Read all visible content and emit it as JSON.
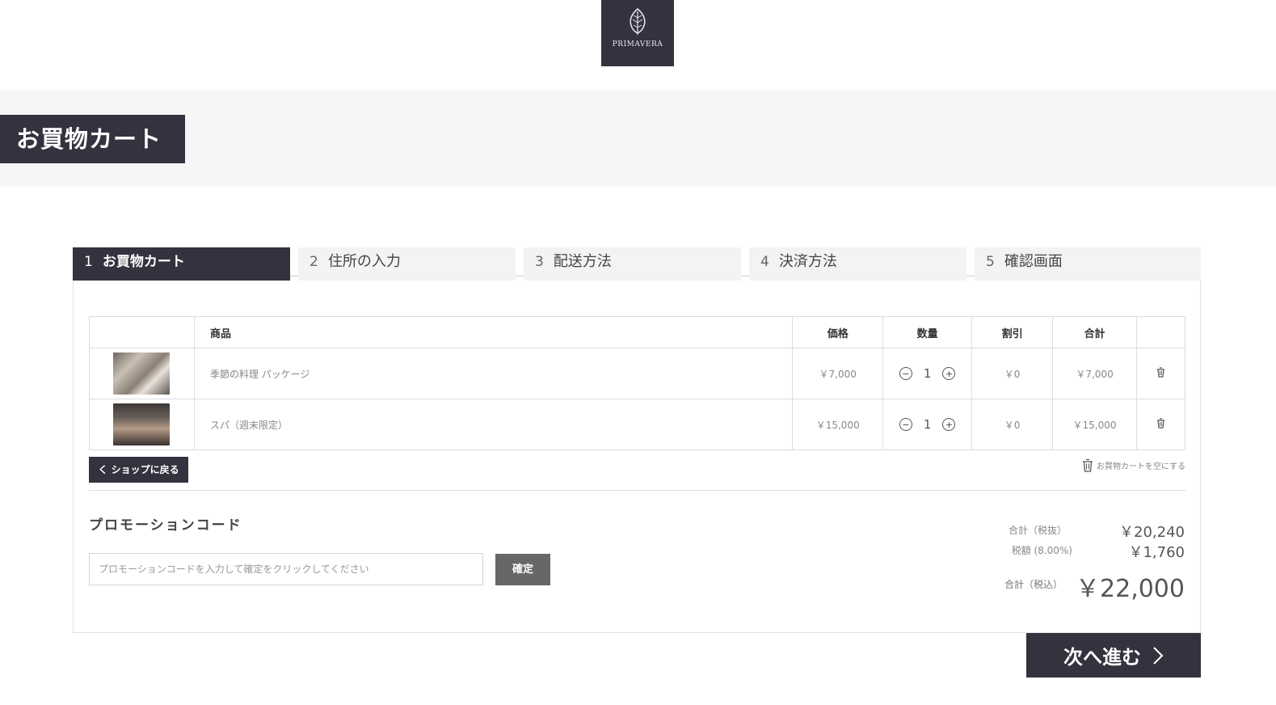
{
  "brand": {
    "name": "PRIMAVERA"
  },
  "page_title": "お買物カート",
  "steps": [
    {
      "num": "1",
      "label": "お買物カート",
      "active": true
    },
    {
      "num": "2",
      "label": "住所の入力",
      "active": false
    },
    {
      "num": "3",
      "label": "配送方法",
      "active": false
    },
    {
      "num": "4",
      "label": "決済方法",
      "active": false
    },
    {
      "num": "5",
      "label": "確認画面",
      "active": false
    }
  ],
  "table": {
    "headers": {
      "product": "商品",
      "price": "価格",
      "qty": "数量",
      "discount": "割引",
      "total": "合計"
    },
    "rows": [
      {
        "name": "季節の料理 パッケージ",
        "price": "￥7,000",
        "qty": "1",
        "discount": "￥0",
        "total": "￥7,000",
        "thumb_icon": "food-photo"
      },
      {
        "name": "スパ（週末限定）",
        "price": "￥15,000",
        "qty": "1",
        "discount": "￥0",
        "total": "￥15,000",
        "thumb_icon": "spa-room-photo"
      }
    ]
  },
  "actions": {
    "back_label": "く ショップに戻る",
    "empty_cart_label": "お買物カートを空にする"
  },
  "promo": {
    "title": "プロモーションコード",
    "placeholder": "プロモーションコードを入力して確定をクリックしてください",
    "value": "",
    "submit_label": "確定"
  },
  "summary": {
    "subtotal_label": "合計（税抜）",
    "subtotal_value": "￥20,240",
    "tax_label": "税額 (8.00%)",
    "tax_value": "￥1,760",
    "grand_label": "合計（税込）",
    "grand_value": "￥22,000"
  },
  "next": {
    "label": "次へ進む"
  },
  "colors": {
    "primary": "#34323e",
    "band": "#f6f6f6",
    "step_inactive": "#f3f3f3",
    "promo_button": "#676767"
  }
}
